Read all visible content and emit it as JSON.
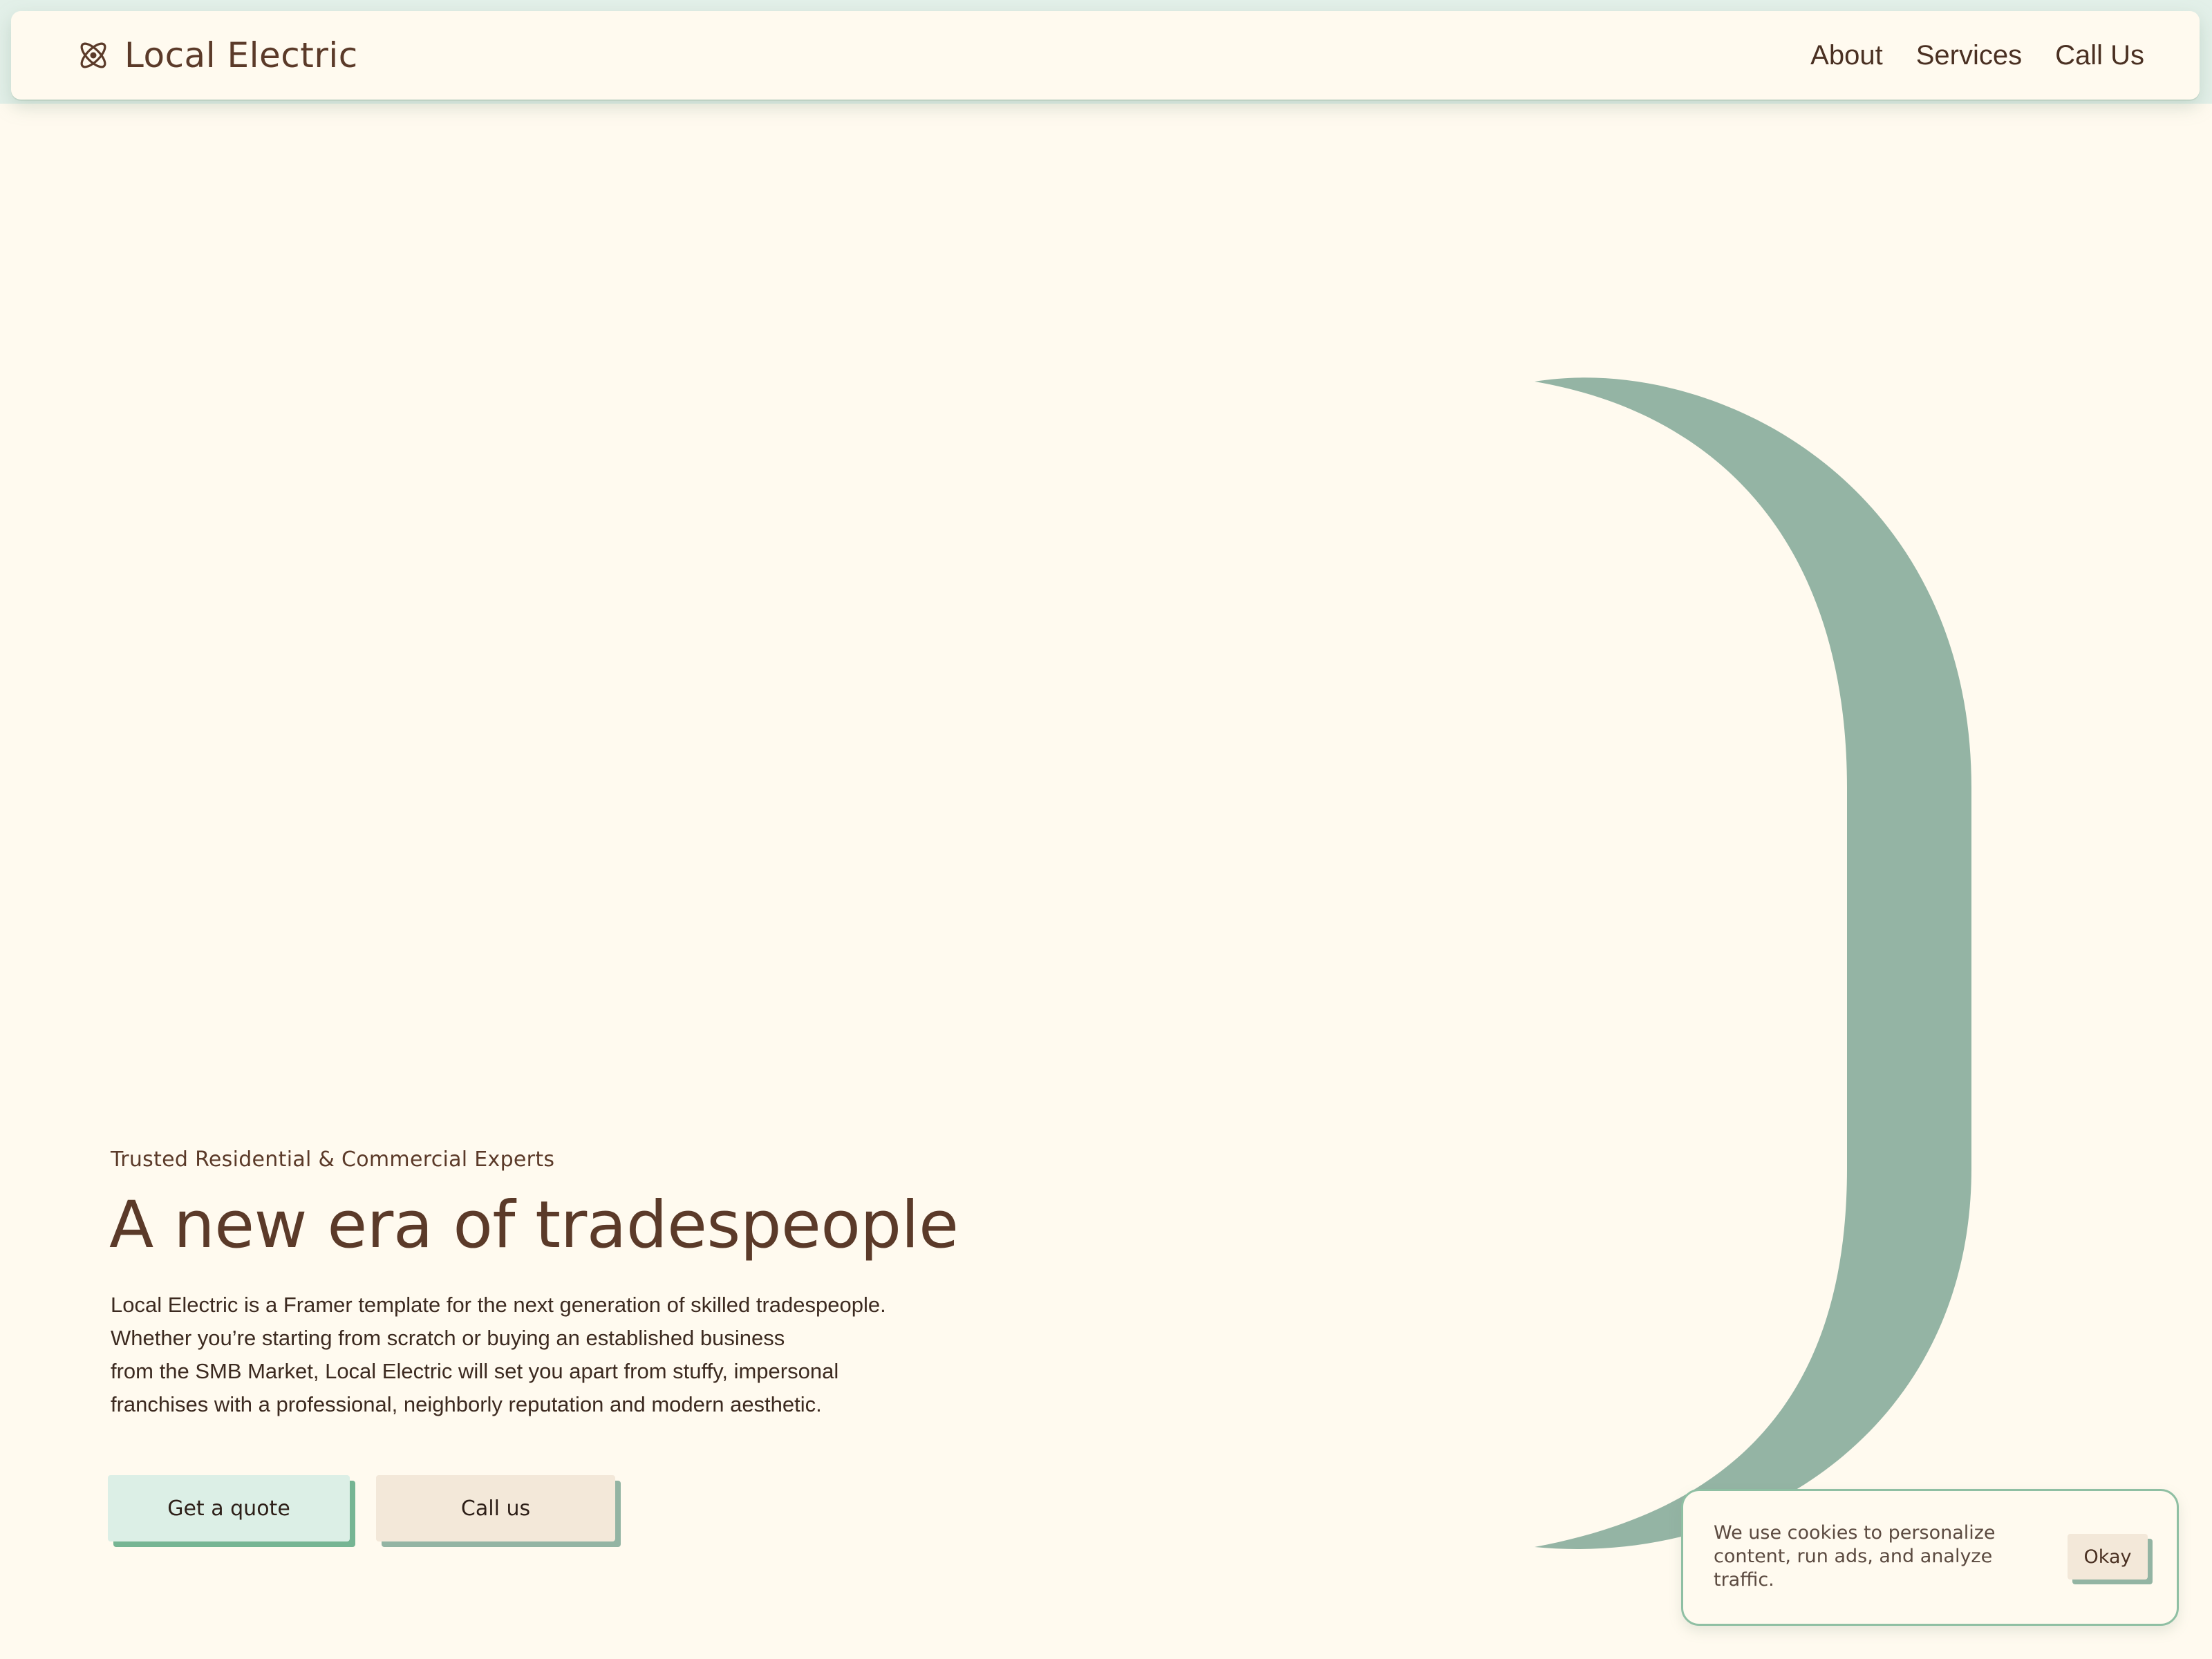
{
  "header": {
    "brand_name": "Local Electric",
    "brand_icon": "atom-icon",
    "nav": [
      "About",
      "Services",
      "Call Us"
    ]
  },
  "hero": {
    "eyebrow": "Trusted Residential & Commercial Experts",
    "title": "A new era of tradespeople",
    "body_lines": [
      "Local Electric is a Framer template for the next generation of skilled tradespeople.",
      "Whether you’re starting from scratch or buying an established business",
      "from the SMB Market, Local Electric will set you apart from stuffy, impersonal",
      "franchises with a professional, neighborly reputation and modern aesthetic."
    ],
    "primary_cta": "Get a quote",
    "secondary_cta": "Call us"
  },
  "cookie_banner": {
    "text": "We use cookies to personalize content, run ads, and analyze traffic.",
    "button": "Okay"
  },
  "colors": {
    "background": "#fffaef",
    "brand_text": "#5b3a29",
    "accent_green": "#94b4a4",
    "mint": "#dcefe6",
    "sand": "#f3e8d9"
  }
}
